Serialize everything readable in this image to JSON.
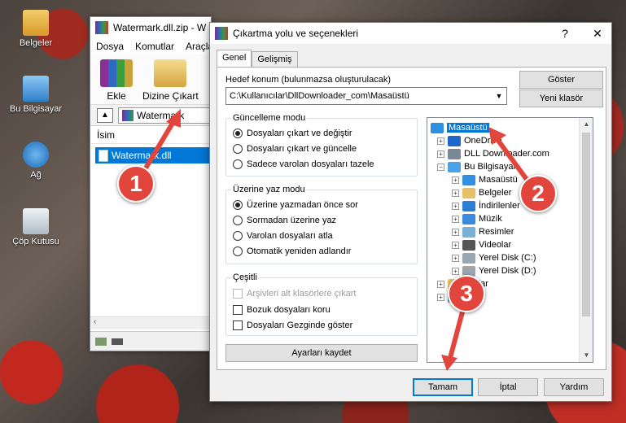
{
  "desktop": {
    "icons": [
      {
        "label": "Belgeler",
        "icon": "folder-documents-icon",
        "color": "#e8b64a"
      },
      {
        "label": "Bu Bilgisayar",
        "icon": "computer-icon",
        "color": "#4aa3e8"
      },
      {
        "label": "Ağ",
        "icon": "network-icon",
        "color": "#3d8fd6"
      },
      {
        "label": "Çöp Kutusu",
        "icon": "recycle-bin-icon",
        "color": "#c7d4dc"
      }
    ]
  },
  "winrar": {
    "title": "Watermark.dll.zip - W",
    "menu": [
      "Dosya",
      "Komutlar",
      "Araçla"
    ],
    "toolbar": {
      "add_label": "Ekle",
      "extract_label": "Dizine Çıkart"
    },
    "path": "Watermark",
    "column_name": "İsim",
    "file": "Watermark.dll"
  },
  "dialog": {
    "title": "Çıkartma yolu ve seçenekleri",
    "help_glyph": "?",
    "close_glyph": "✕",
    "tabs": [
      "Genel",
      "Gelişmiş"
    ],
    "target_label": "Hedef konum (bulunmazsa oluşturulacak)",
    "target_value": "C:\\Kullanıcılar\\DllDownloader_com\\Masaüstü",
    "show_button": "Göster",
    "new_folder_button": "Yeni klasör",
    "update_mode": {
      "title": "Güncelleme modu",
      "options": [
        "Dosyaları çıkart ve değiştir",
        "Dosyaları çıkart ve güncelle",
        "Sadece varolan dosyaları tazele"
      ],
      "selected": 0
    },
    "overwrite_mode": {
      "title": "Üzerine yaz modu",
      "options": [
        "Üzerine yazmadan önce sor",
        "Sormadan üzerine yaz",
        "Varolan dosyaları atla",
        "Otomatik yeniden adlandır"
      ],
      "selected": 0
    },
    "misc": {
      "title": "Çeşitli",
      "options": [
        {
          "label": "Arşivleri alt klasörlere çıkart",
          "disabled": true
        },
        {
          "label": "Bozuk dosyaları koru",
          "disabled": false
        },
        {
          "label": "Dosyaları Gezginde göster",
          "disabled": false
        }
      ]
    },
    "save_settings_button": "Ayarları kaydet",
    "tree": [
      {
        "label": "Masaüstü",
        "icon": "desktop-icon",
        "color": "#2f8fe0",
        "selected": true
      },
      {
        "label": "OneDrive",
        "icon": "onedrive-icon",
        "color": "#1e66c9",
        "exp": "+"
      },
      {
        "label": "DLL Downloader.com",
        "icon": "user-icon",
        "color": "#7a8896",
        "exp": "+"
      },
      {
        "label": "Bu Bilgisayar",
        "icon": "computer-icon",
        "color": "#4aa3e8",
        "exp": "−"
      },
      {
        "label": "Masaüstü",
        "icon": "desktop-icon",
        "color": "#2f8fe0",
        "exp": "+"
      },
      {
        "label": "Belgeler",
        "icon": "documents-icon",
        "color": "#e8c064",
        "exp": "+"
      },
      {
        "label": "İndirilenler",
        "icon": "download-icon",
        "color": "#2a7fd4",
        "exp": "+"
      },
      {
        "label": "Müzik",
        "icon": "music-icon",
        "color": "#3a8be0",
        "exp": "+"
      },
      {
        "label": "Resimler",
        "icon": "pictures-icon",
        "color": "#78b0d8",
        "exp": "+"
      },
      {
        "label": "Videolar",
        "icon": "videos-icon",
        "color": "#555555",
        "exp": "+"
      },
      {
        "label": "Yerel Disk (C:)",
        "icon": "drive-icon",
        "color": "#9aa6b0",
        "exp": "+"
      },
      {
        "label": "Yerel Disk (D:)",
        "icon": "drive-icon",
        "color": "#9aa6b0",
        "exp": "+"
      },
      {
        "label": "...ıklar",
        "icon": "library-icon",
        "color": "#e8c064",
        "exp": "+"
      },
      {
        "label": "",
        "icon": "network-icon",
        "color": "#3d8fd6",
        "exp": "+"
      }
    ],
    "ok_button": "Tamam",
    "cancel_button": "İptal",
    "help_button": "Yardım"
  },
  "callouts": [
    "1",
    "2",
    "3"
  ],
  "accent": "#0078d7",
  "callout_color": "#e2453c"
}
